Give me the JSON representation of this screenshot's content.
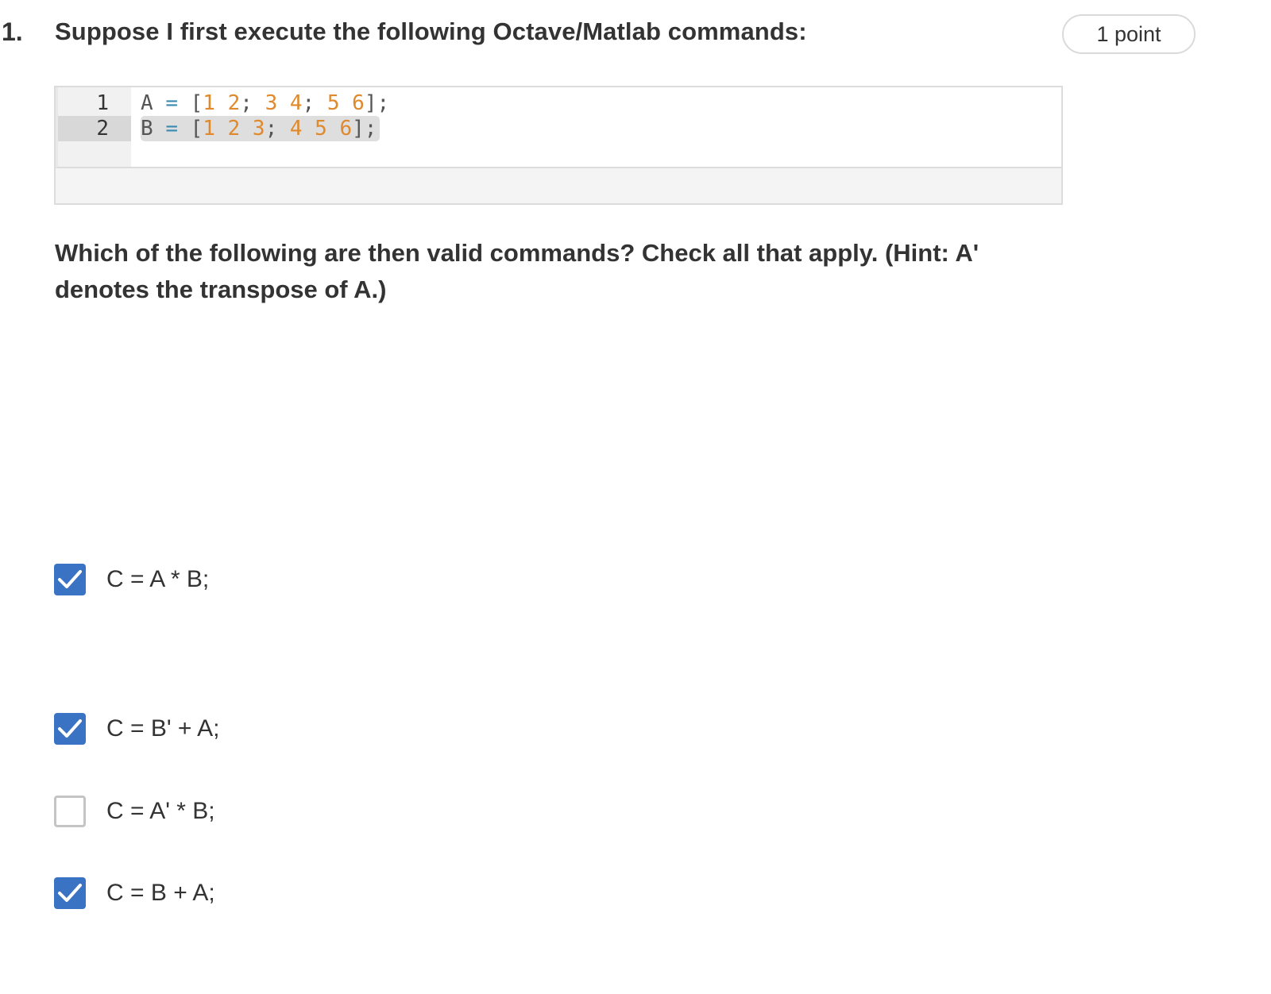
{
  "question": {
    "number": "1.",
    "title": "Suppose I first execute the following Octave/Matlab commands:",
    "points": "1 point"
  },
  "code": {
    "lines": [
      {
        "number": "1",
        "var": "A",
        "op": "=",
        "tokens": [
          {
            "t": "punct",
            "v": "["
          },
          {
            "t": "num",
            "v": "1 2"
          },
          {
            "t": "punct",
            "v": "; "
          },
          {
            "t": "num",
            "v": "3 4"
          },
          {
            "t": "punct",
            "v": "; "
          },
          {
            "t": "num",
            "v": "5 6"
          },
          {
            "t": "punct",
            "v": "];"
          }
        ]
      },
      {
        "number": "2",
        "var": "B",
        "op": "=",
        "tokens": [
          {
            "t": "punct",
            "v": "["
          },
          {
            "t": "num",
            "v": "1 2 3"
          },
          {
            "t": "punct",
            "v": "; "
          },
          {
            "t": "num",
            "v": "4 5 6"
          },
          {
            "t": "punct",
            "v": "];"
          }
        ]
      }
    ]
  },
  "instructions": "Which of the following are then valid commands? Check all that apply. (Hint: A' denotes the transpose of A.)",
  "options": [
    {
      "label": "C = A * B;",
      "checked": true
    },
    {
      "label": "C = B' + A;",
      "checked": true
    },
    {
      "label": "C = A' * B;",
      "checked": false
    },
    {
      "label": "C = B + A;",
      "checked": true
    }
  ],
  "colors": {
    "checkbox_checked": "#3a72c4",
    "checkbox_unchecked_border": "#c4c4c4",
    "code_number": "#e0892c",
    "code_operator": "#3a8ab0"
  }
}
